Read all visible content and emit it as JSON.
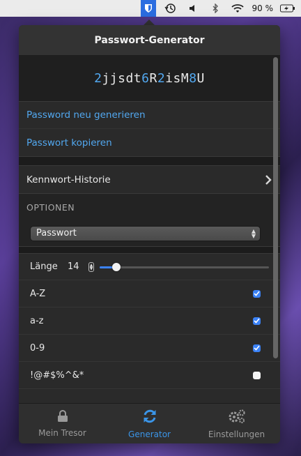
{
  "menubar": {
    "battery": "90 %"
  },
  "popover": {
    "title": "Passwort-Generator"
  },
  "password": {
    "parts": [
      {
        "text": "2",
        "num": true
      },
      {
        "text": "jjsdt",
        "num": false
      },
      {
        "text": "6",
        "num": true
      },
      {
        "text": "R",
        "num": false
      },
      {
        "text": "2",
        "num": true
      },
      {
        "text": "isM",
        "num": false
      },
      {
        "text": "8",
        "num": true
      },
      {
        "text": "U",
        "num": false
      }
    ]
  },
  "actions": {
    "regenerate": "Password neu generieren",
    "copy": "Passwort kopieren"
  },
  "history": {
    "label": "Kennwort-Historie"
  },
  "options": {
    "header": "OPTIONEN",
    "type_selected": "Passwort",
    "length_label": "Länge",
    "length_value": "14",
    "length_fraction": 0.1,
    "checks": [
      {
        "label": "A-Z",
        "checked": true
      },
      {
        "label": "a-z",
        "checked": true
      },
      {
        "label": "0-9",
        "checked": true
      },
      {
        "label": "!@#$%^&*",
        "checked": false
      }
    ]
  },
  "tabs": [
    {
      "label": "Mein Tresor",
      "icon": "lock-icon",
      "active": false
    },
    {
      "label": "Generator",
      "icon": "refresh-icon",
      "active": true
    },
    {
      "label": "Einstellungen",
      "icon": "gears-icon",
      "active": false
    }
  ],
  "colors": {
    "accent": "#3b95e8",
    "link": "#52a8f0"
  }
}
